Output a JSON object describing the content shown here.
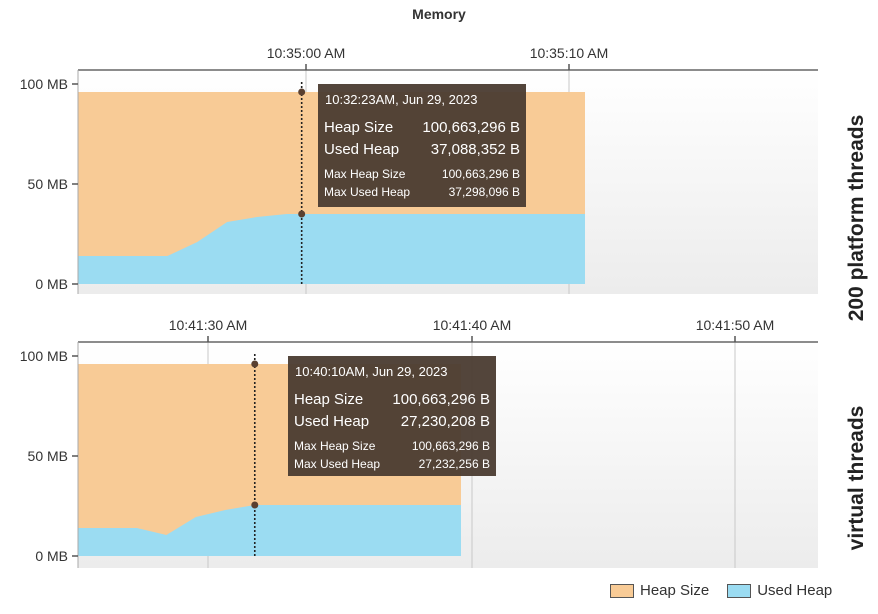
{
  "title": "Memory",
  "colors": {
    "heap": "#f8cb96",
    "used": "#9bdcf2",
    "tooltip_bg": "#4a3b30",
    "grid": "#c8c8c8",
    "bg": "#f0f0f0"
  },
  "legend": [
    {
      "label": "Heap Size",
      "color": "#f8cb96"
    },
    {
      "label": "Used Heap",
      "color": "#9bdcf2"
    }
  ],
  "chart_data": [
    {
      "type": "area",
      "side_label": "200 platform threads",
      "x_ticks": [
        "10:35:00 AM",
        "10:35:10 AM"
      ],
      "y_ticks": [
        "0 MB",
        "50 MB",
        "100 MB"
      ],
      "ylim": [
        0,
        100
      ],
      "series": [
        {
          "name": "Heap Size",
          "x": [
            0,
            1,
            2,
            3,
            4,
            5,
            6,
            7,
            8,
            9,
            10,
            11,
            12,
            13,
            14,
            15,
            16,
            17
          ],
          "values": [
            96,
            96,
            96,
            96,
            96,
            96,
            96,
            96,
            96,
            96,
            96,
            96,
            96,
            96,
            96,
            96,
            96,
            96
          ]
        },
        {
          "name": "Used Heap",
          "x": [
            0,
            1,
            2,
            3,
            4,
            5,
            6,
            7,
            8,
            9,
            10,
            11,
            12,
            13,
            14,
            15,
            16,
            17
          ],
          "values": [
            14,
            14,
            14,
            14,
            21,
            31,
            33.5,
            35,
            35,
            35,
            35,
            35,
            35,
            35,
            35,
            35,
            35,
            35
          ]
        }
      ],
      "cursor_x": 7.5,
      "tooltip": {
        "header": "10:32:23AM, Jun 29, 2023",
        "rows_big": [
          {
            "label": "Heap Size",
            "value": "100,663,296 B"
          },
          {
            "label": "Used Heap",
            "value": "37,088,352 B"
          }
        ],
        "rows_small": [
          {
            "label": "Max Heap Size",
            "value": "100,663,296 B"
          },
          {
            "label": "Max Used Heap",
            "value": "37,298,096 B"
          }
        ]
      }
    },
    {
      "type": "area",
      "side_label": "virtual threads",
      "x_ticks": [
        "10:41:30 AM",
        "10:41:40 AM",
        "10:41:50 AM"
      ],
      "y_ticks": [
        "0 MB",
        "50 MB",
        "100 MB"
      ],
      "ylim": [
        0,
        100
      ],
      "series": [
        {
          "name": "Heap Size",
          "x": [
            0,
            1,
            2,
            3,
            4,
            5,
            6,
            7,
            8,
            9,
            10,
            11,
            12,
            13
          ],
          "values": [
            96,
            96,
            96,
            96,
            96,
            96,
            96,
            96,
            96,
            96,
            96,
            96,
            96,
            96
          ]
        },
        {
          "name": "Used Heap",
          "x": [
            0,
            1,
            2,
            3,
            4,
            5,
            6,
            7,
            8,
            9,
            10,
            11,
            12,
            13
          ],
          "values": [
            14,
            14,
            14,
            10.5,
            19.5,
            23,
            25.5,
            25.5,
            25.5,
            25.5,
            25.5,
            25.5,
            25.5,
            25.5
          ]
        }
      ],
      "cursor_x": 6,
      "tooltip": {
        "header": "10:40:10AM, Jun 29, 2023",
        "rows_big": [
          {
            "label": "Heap Size",
            "value": "100,663,296 B"
          },
          {
            "label": "Used Heap",
            "value": "27,230,208 B"
          }
        ],
        "rows_small": [
          {
            "label": "Max Heap Size",
            "value": "100,663,296 B"
          },
          {
            "label": "Max Used Heap",
            "value": "27,232,256 B"
          }
        ]
      }
    }
  ]
}
